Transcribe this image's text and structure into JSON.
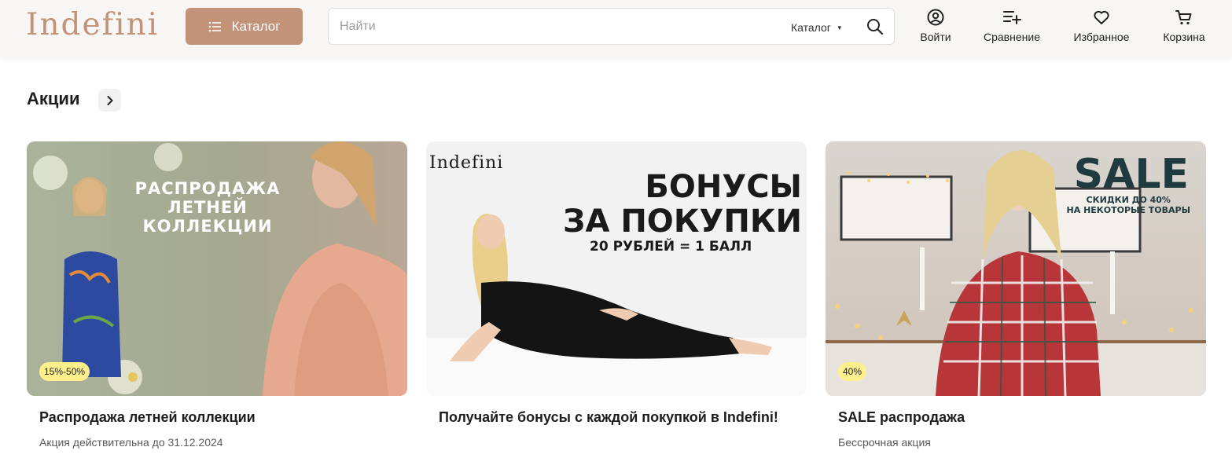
{
  "header": {
    "logo_text": "Indefini",
    "catalog_button": "Каталог",
    "search": {
      "placeholder": "Найти",
      "scope_label": "Каталог"
    },
    "actions": [
      {
        "label": "Войти",
        "icon": "user-circle-icon"
      },
      {
        "label": "Сравнение",
        "icon": "compare-list-icon"
      },
      {
        "label": "Избранное",
        "icon": "heart-icon"
      },
      {
        "label": "Корзина",
        "icon": "cart-icon"
      }
    ]
  },
  "section": {
    "title": "Акции"
  },
  "cards": [
    {
      "banner_lines": [
        "РАСПРОДАЖА",
        "ЛЕТНЕЙ",
        "КОЛЛЕКЦИИ"
      ],
      "badge": "15%-50%",
      "title": "Распродажа летней коллекции",
      "subtitle": "Акция действительна до 31.12.2024"
    },
    {
      "banner_brand": "Indefini",
      "banner_lines": [
        "БОНУСЫ",
        "ЗА ПОКУПКИ"
      ],
      "banner_sub": "20 РУБЛЕЙ = 1 БАЛЛ",
      "title": "Получайте бонусы с каждой покупкой в Indefini!"
    },
    {
      "banner_headline": "SALE",
      "banner_lines": [
        "СКИДКИ ДО 40%",
        "НА НЕКОТОРЫЕ ТОВАРЫ"
      ],
      "badge": "40%",
      "title": "SALE распродажа",
      "subtitle": "Бессрочная акция"
    }
  ],
  "colors": {
    "brand": "#c29378",
    "header_bg": "#f7f6f4",
    "badge_bg": "#fdf08c"
  }
}
